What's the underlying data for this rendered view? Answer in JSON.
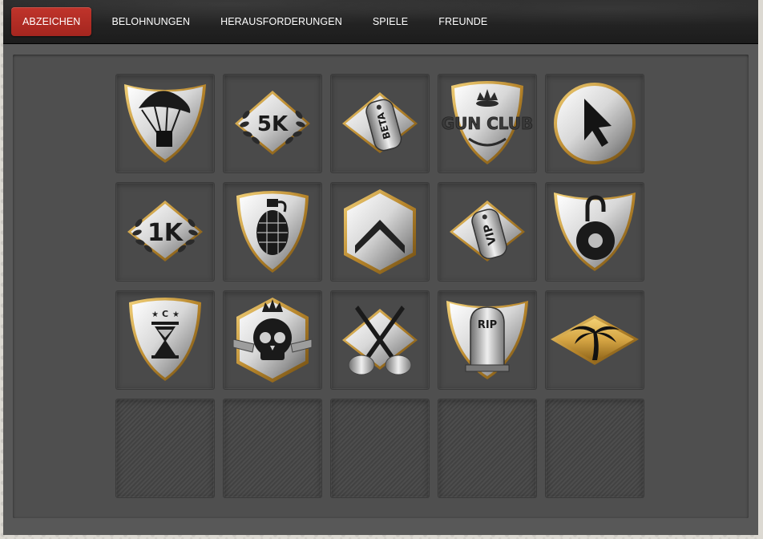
{
  "nav": {
    "tabs": [
      {
        "label": "ABZEICHEN",
        "active": true
      },
      {
        "label": "BELOHNUNGEN",
        "active": false
      },
      {
        "label": "HERAUSFORDERUNGEN",
        "active": false
      },
      {
        "label": "SPIELE",
        "active": false
      },
      {
        "label": "FREUNDE",
        "active": false
      }
    ]
  },
  "badges": [
    {
      "icon": "parachute-shield-icon"
    },
    {
      "icon": "5k-laurel-diamond-icon",
      "text": "5K"
    },
    {
      "icon": "beta-dogtag-diamond-icon",
      "text": "BETA"
    },
    {
      "icon": "gun-club-shield-icon",
      "text": "GUN CLUB"
    },
    {
      "icon": "cursor-circle-icon"
    },
    {
      "icon": "1k-laurel-diamond-icon",
      "text": "1K"
    },
    {
      "icon": "grenade-shield-icon"
    },
    {
      "icon": "chevron-rank-hexagon-icon"
    },
    {
      "icon": "vip-dogtag-diamond-icon",
      "text": "VIP"
    },
    {
      "icon": "padlock-shield-icon"
    },
    {
      "icon": "hourglass-shield-icon",
      "text": "C"
    },
    {
      "icon": "crowned-skull-hexagon-icon"
    },
    {
      "icon": "crossed-knives-diamond-icon"
    },
    {
      "icon": "rip-tombstone-shield-icon",
      "text": "RIP"
    },
    {
      "icon": "palm-tree-gold-diamond-icon"
    }
  ],
  "empty_slots": 5,
  "colors": {
    "accent_tab": "#b52d25",
    "gold": "#c89a3a",
    "panel": "#585858"
  }
}
